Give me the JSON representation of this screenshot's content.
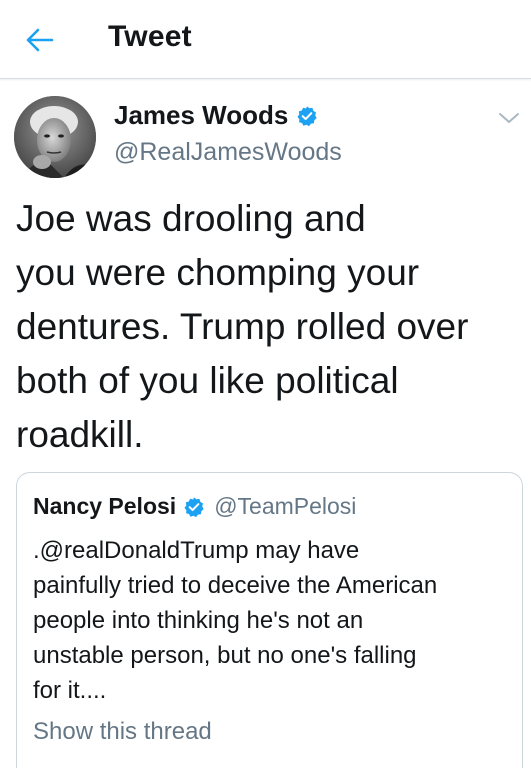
{
  "header": {
    "title": "Tweet",
    "back_icon": "arrow-left-icon",
    "accent_color": "#1da1f2"
  },
  "tweet": {
    "author_name": "James Woods",
    "author_handle": "@RealJamesWoods",
    "verified_icon": "verified-badge-icon",
    "menu_icon": "chevron-down-icon",
    "text": "Joe was drooling and\nyou were chomping your\ndentures. Trump rolled over\nboth of you like political\nroadkill."
  },
  "quoted_tweet": {
    "author_name": "Nancy Pelosi",
    "author_handle": "@TeamPelosi",
    "verified_icon": "verified-badge-icon",
    "text": ".@realDonaldTrump may have\npainfully tried to deceive the American\npeople into thinking he's not an\nunstable person, but no one's falling\nfor it....",
    "show_thread_label": "Show this thread"
  },
  "colors": {
    "text_primary": "#14171a",
    "text_secondary": "#657786",
    "verified": "#1da1f2",
    "border": "#ccd6dd"
  }
}
